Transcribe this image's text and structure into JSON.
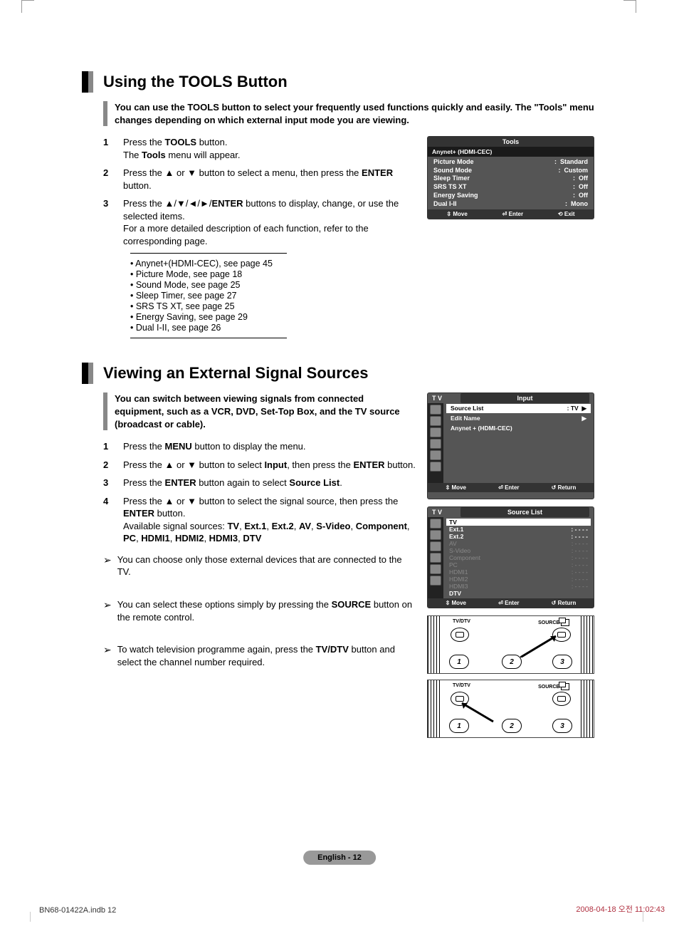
{
  "section1": {
    "title": "Using the TOOLS Button",
    "intro": "You can use the TOOLS button to select your frequently used functions quickly and easily. The \"Tools\" menu changes depending on which external input mode you are viewing.",
    "steps": {
      "s1_pre": "Press the ",
      "s1_bold": "TOOLS",
      "s1_post": " button.",
      "s1_line2a": "The ",
      "s1_line2b": "Tools",
      "s1_line2c": " menu will appear.",
      "s2_pre": "Press the ▲ or ▼ button to select a menu, then press the ",
      "s2_bold": "ENTER",
      "s2_post": " button.",
      "s3_pre": "Press the ▲/▼/◄/►/",
      "s3_bold": "ENTER",
      "s3_post": " buttons to display, change, or use the selected items.",
      "s3_line2": "For a more detailed description of each function, refer to the corresponding page."
    },
    "refs": [
      "• Anynet+(HDMI-CEC), see page 45",
      "• Picture Mode, see page 18",
      "• Sound Mode, see page 25",
      "• Sleep Timer, see page 27",
      "• SRS TS XT, see page 25",
      "• Energy Saving, see page 29",
      "• Dual I-II, see page 26"
    ]
  },
  "osd_tools": {
    "title": "Tools",
    "header2": "Anynet+ (HDMI-CEC)",
    "rows": [
      {
        "label": "Picture Mode",
        "value": "Standard"
      },
      {
        "label": "Sound Mode",
        "value": "Custom"
      },
      {
        "label": "Sleep Timer",
        "value": "Off"
      },
      {
        "label": "SRS TS XT",
        "value": "Off"
      },
      {
        "label": "Energy Saving",
        "value": "Off"
      },
      {
        "label": "Dual I-II",
        "value": "Mono"
      }
    ],
    "footer": {
      "move": "Move",
      "enter": "Enter",
      "exit": "Exit"
    }
  },
  "section2": {
    "title": "Viewing an External Signal Sources",
    "intro": "You can switch between viewing signals from connected equipment, such as a VCR, DVD, Set-Top Box, and the TV source (broadcast or cable).",
    "steps": {
      "s1_pre": "Press the ",
      "s1_bold": "MENU",
      "s1_post": " button to display the menu.",
      "s2_a": "Press the ▲ or ▼ button to select ",
      "s2_b": "Input",
      "s2_c": ", then press the ",
      "s2_d": "ENTER",
      "s2_e": " button.",
      "s3_a": "Press the ",
      "s3_b": "ENTER",
      "s3_c": " button again to select ",
      "s3_d": "Source List",
      "s3_e": ".",
      "s4_a": "Press the ▲ or ▼ button to select the signal source, then press the ",
      "s4_b": "ENTER",
      "s4_c": " button.",
      "s4_line2_a": "Available signal sources: ",
      "s4_line2_b": "TV",
      "s4_line2_c": ", ",
      "s4_line2_d": "Ext.1",
      "s4_line2_e": ", ",
      "s4_line2_f": "Ext.2",
      "s4_line2_g": ", ",
      "s4_line2_h": "AV",
      "s4_line2_i": ", ",
      "s4_line2_j": "S-Video",
      "s4_line2_k": ", ",
      "s4_line2_l": "Component",
      "s4_line2_m": ", ",
      "s4_line2_n": "PC",
      "s4_line2_o": ", ",
      "s4_line2_p": "HDMI1",
      "s4_line2_q": ", ",
      "s4_line2_r": "HDMI2",
      "s4_line2_s": ", ",
      "s4_line2_t": "HDMI3",
      "s4_line2_u": ", ",
      "s4_line2_v": "DTV"
    },
    "notes": {
      "n1": "You can choose only those external devices that are connected to the TV.",
      "n2_a": "You can select these options simply by pressing the ",
      "n2_b": "SOURCE",
      "n2_c": " button on the remote control.",
      "n3_a": "To watch television programme again, press the ",
      "n3_b": "TV/DTV",
      "n3_c": " button and select the channel number required."
    }
  },
  "osd_input": {
    "tv_tag": "T V",
    "title": "Input",
    "items": [
      {
        "label": "Source List",
        "value": ": TV",
        "arrow": "▶"
      },
      {
        "label": "Edit Name",
        "value": "",
        "arrow": "▶"
      },
      {
        "label": "Anynet + (HDMI-CEC)",
        "value": "",
        "arrow": ""
      }
    ],
    "footer": {
      "move": "Move",
      "enter": "Enter",
      "return": "Return"
    }
  },
  "osd_sourcelist": {
    "tv_tag": "T V",
    "title": "Source List",
    "rows": [
      {
        "label": "TV",
        "value": "",
        "lit": true,
        "sel": true
      },
      {
        "label": "Ext.1",
        "value": ": - - - -",
        "lit": true
      },
      {
        "label": "Ext.2",
        "value": ": - - - -",
        "lit": true
      },
      {
        "label": "AV",
        "value": ": - - - -",
        "lit": false
      },
      {
        "label": "S-Video",
        "value": ": - - - -",
        "lit": false
      },
      {
        "label": "Component",
        "value": ": - - - -",
        "lit": false
      },
      {
        "label": "PC",
        "value": ": - - - -",
        "lit": false
      },
      {
        "label": "HDMI1",
        "value": ": - - - -",
        "lit": false
      },
      {
        "label": "HDMI2",
        "value": ": - - - -",
        "lit": false
      },
      {
        "label": "HDMI3",
        "value": ": - - - -",
        "lit": false
      },
      {
        "label": "DTV",
        "value": "",
        "lit": true
      }
    ],
    "footer": {
      "move": "Move",
      "enter": "Enter",
      "return": "Return"
    }
  },
  "remote": {
    "tv_label": "TV/DTV",
    "source_label": "SOURCE",
    "b1": "1",
    "b2": "2",
    "b3": "3"
  },
  "footer": {
    "page": "English - 12",
    "doc": "BN68-01422A.indb   12",
    "date": "2008-04-18   오전 11:02:43"
  },
  "nums": {
    "n1": "1",
    "n2": "2",
    "n3": "3",
    "n4": "4"
  },
  "arrow": "➢",
  "updown": "⇳",
  "enter_icon": "⏎",
  "return_icon": "↺",
  "exit_icon": "⟲"
}
